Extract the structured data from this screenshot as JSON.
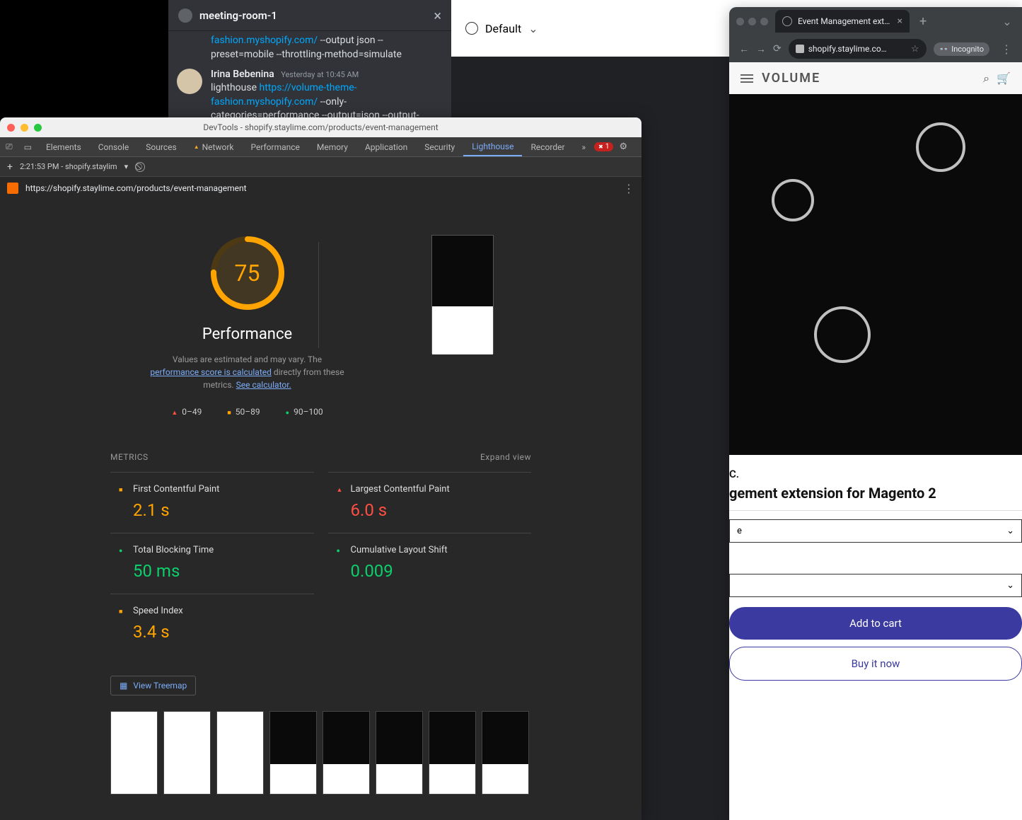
{
  "bg_shopify": {
    "label": "Default"
  },
  "chrome": {
    "tab_title": "Event Management extensio…",
    "url": "shopify.staylime.co…",
    "incognito": "Incognito",
    "header": "VOLUME",
    "product_vendor_frag": "C.",
    "product_title_frag": "gement extension for Magento 2",
    "select_placeholder": "",
    "addcart": "Add to cart",
    "buynow": "Buy it now"
  },
  "chat": {
    "room": "meeting-room-1",
    "msg1_pre": "fashion.myshopify.com/",
    "msg1_post": " --output json --preset=mobile --throttling-method=simulate",
    "author": "Irina Bebenina",
    "time": "Yesterday at 10:45 AM",
    "msg2_pre": "lighthouse ",
    "msg2_link": "https://volume-theme-fashion.myshopify.com/",
    "msg2_post": " --only-categories=performance --output=json --output-"
  },
  "devtools": {
    "title": "DevTools - shopify.staylime.com/products/event-management",
    "tabs": [
      "Elements",
      "Console",
      "Sources",
      "Network",
      "Performance",
      "Memory",
      "Application",
      "Security",
      "Lighthouse",
      "Recorder"
    ],
    "error_count": "1",
    "subbar_time": "2:21:53 PM - shopify.staylim",
    "url": "https://shopify.staylime.com/products/event-management",
    "score": "75",
    "perf_label": "Performance",
    "disclaimer_pre": "Values are estimated and may vary. The ",
    "disclaimer_link1": "performance score is calculated",
    "disclaimer_mid": " directly from these metrics. ",
    "disclaimer_link2": "See calculator.",
    "legend": [
      "0–49",
      "50–89",
      "90–100"
    ],
    "metrics_label": "METRICS",
    "expand": "Expand view",
    "metrics": [
      {
        "name": "First Contentful Paint",
        "value": "2.1 s",
        "state": "orange"
      },
      {
        "name": "Largest Contentful Paint",
        "value": "6.0 s",
        "state": "red"
      },
      {
        "name": "Total Blocking Time",
        "value": "50 ms",
        "state": "green"
      },
      {
        "name": "Cumulative Layout Shift",
        "value": "0.009",
        "state": "green"
      },
      {
        "name": "Speed Index",
        "value": "3.4 s",
        "state": "orange"
      }
    ],
    "treemap": "View Treemap"
  }
}
